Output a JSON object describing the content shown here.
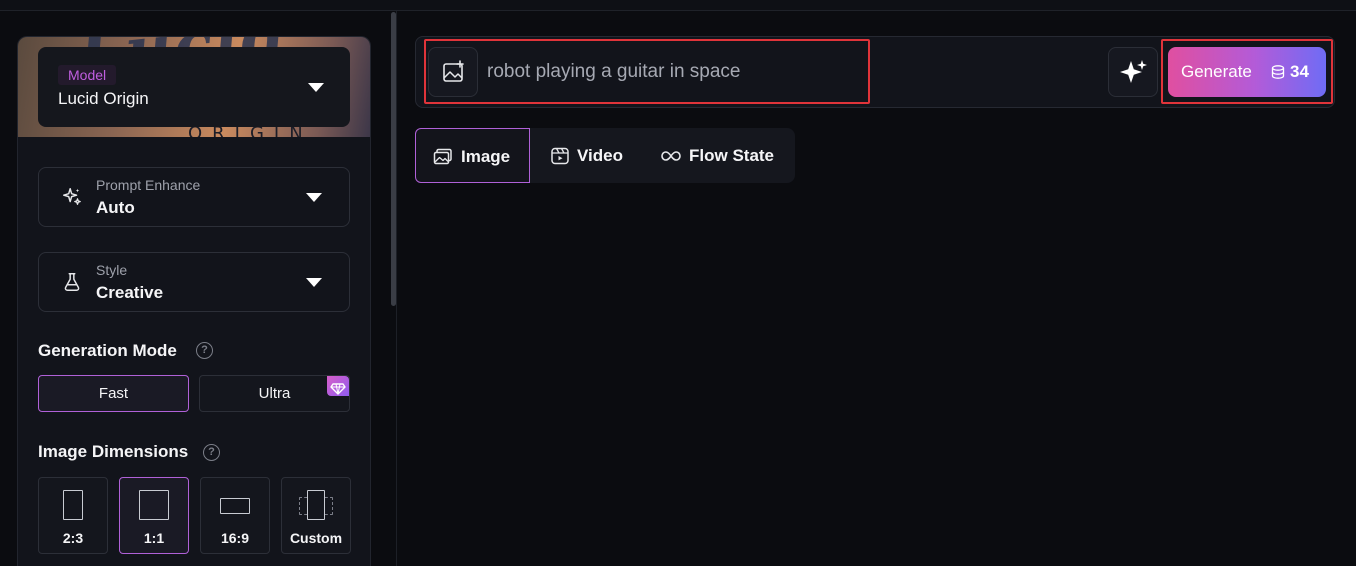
{
  "sidebar": {
    "model": {
      "tag": "Model",
      "name": "Lucid Origin",
      "banner_text": "Lucid",
      "banner_sub": "ORIGIN"
    },
    "prompt_enhance": {
      "label": "Prompt Enhance",
      "value": "Auto"
    },
    "style": {
      "label": "Style",
      "value": "Creative"
    },
    "generation_mode": {
      "title": "Generation Mode",
      "help": "?",
      "options": [
        {
          "label": "Fast",
          "selected": true
        },
        {
          "label": "Ultra",
          "selected": false
        }
      ]
    },
    "image_dimensions": {
      "title": "Image Dimensions",
      "help": "?",
      "options": [
        {
          "label": "2:3",
          "selected": false
        },
        {
          "label": "1:1",
          "selected": true
        },
        {
          "label": "16:9",
          "selected": false
        },
        {
          "label": "Custom",
          "selected": false
        }
      ]
    }
  },
  "prompt": {
    "value": "robot playing a guitar in space",
    "upload_icon": "image-upload-icon",
    "magic_icon": "sparkles-icon"
  },
  "generate": {
    "label": "Generate",
    "cost": "34",
    "icon": "coins-icon"
  },
  "tabs": [
    {
      "label": "Image",
      "icon": "image-icon",
      "active": true
    },
    {
      "label": "Video",
      "icon": "video-icon",
      "active": false
    },
    {
      "label": "Flow State",
      "icon": "infinity-icon",
      "active": false
    }
  ],
  "colors": {
    "accent": "#b061d8",
    "highlight": "#e0343a",
    "generate_gradient_start": "#e04fa0",
    "generate_gradient_end": "#6f6cf5"
  }
}
